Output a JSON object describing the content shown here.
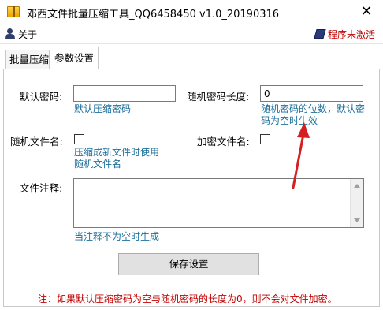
{
  "window": {
    "title": "邓西文件批量压缩工具_QQ6458450 v1.0_20190316",
    "close_symbol": "✕",
    "icon": "archive-icon"
  },
  "menu": {
    "about_label": "关于",
    "about_icon": "user-icon",
    "activate_label": "程序未激活",
    "activate_icon": "book-icon",
    "activate_color": "#c00000"
  },
  "tabs": [
    {
      "label": "批量压缩",
      "active": false
    },
    {
      "label": "参数设置",
      "active": true
    }
  ],
  "form": {
    "default_password": {
      "label": "默认密码:",
      "value": "",
      "hint": "默认压缩密码"
    },
    "random_password_length": {
      "label": "随机密码长度:",
      "value": "0",
      "hint_line1": "随机密码的位数，默认密",
      "hint_line2": "码为空时生效"
    },
    "random_filename": {
      "label": "随机文件名:",
      "checked": false,
      "hint_line1": "压缩成新文件时使用",
      "hint_line2": "随机文件名"
    },
    "encrypt_filename": {
      "label": "加密文件名:",
      "checked": false
    },
    "file_comment": {
      "label": "文件注释:",
      "value": "",
      "hint": "当注释不为空时生成"
    },
    "save_button": "保存设置"
  },
  "note": "注：如果默认压缩密码为空与随机密码的长度为0，则不会对文件加密。",
  "colors": {
    "hint": "#1d6f9b",
    "note": "#c00000",
    "arrow": "#d42020"
  }
}
